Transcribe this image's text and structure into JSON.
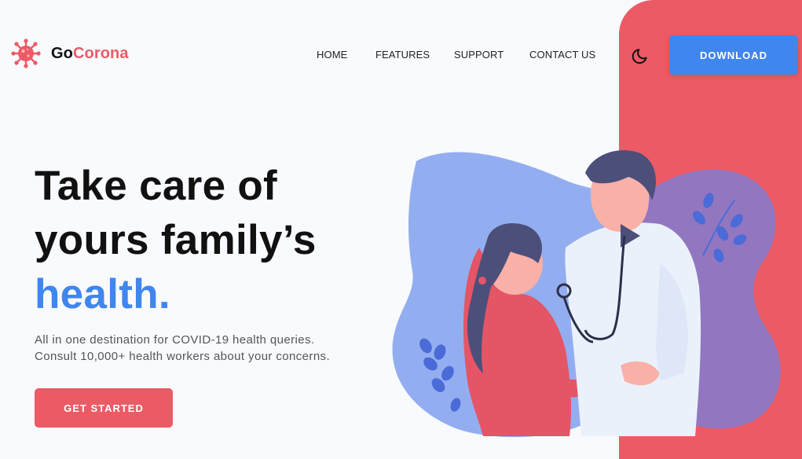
{
  "brand": {
    "prefix": "Go",
    "suffix": "Corona",
    "accent_color": "#ec5a65",
    "icon": "virus-icon"
  },
  "nav": {
    "items": [
      {
        "label": "HOME"
      },
      {
        "label": "FEATURES"
      },
      {
        "label": "SUPPORT"
      },
      {
        "label": "CONTACT US"
      }
    ],
    "theme_toggle_icon": "moon-icon",
    "download_label": "DOWNLOAD"
  },
  "hero": {
    "line1": "Take care of",
    "line2": "yours family’s",
    "line3": "health.",
    "subtitle_line1": "All in one destination for COVID-19 health queries.",
    "subtitle_line2": "Consult 10,000+ health workers about your concerns.",
    "cta_label": "GET STARTED",
    "illustration": "doctor-patient-illustration"
  },
  "colors": {
    "primary": "#3f86ef",
    "accent": "#ec5a65",
    "background": "#f8fafd"
  }
}
